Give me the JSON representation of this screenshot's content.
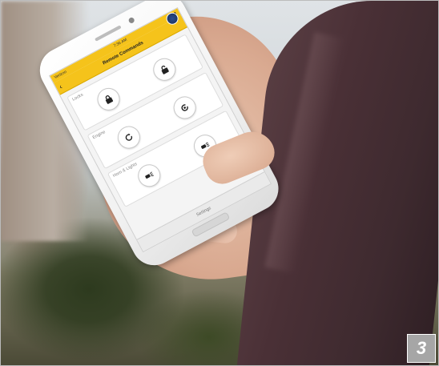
{
  "statusbar": {
    "carrier": "Verizon",
    "time": "7:36 AM",
    "battery": ""
  },
  "header": {
    "title": "Remote Commands"
  },
  "sections": [
    {
      "label": "Locks",
      "buttons": [
        {
          "icon": "lock-icon"
        },
        {
          "icon": "unlock-icon"
        }
      ]
    },
    {
      "label": "Engine",
      "buttons": [
        {
          "icon": "engine-start-icon"
        },
        {
          "icon": "engine-stop-icon"
        }
      ]
    },
    {
      "label": "Horn & Lights",
      "buttons": [
        {
          "icon": "horn-lights-icon"
        },
        {
          "icon": "lights-icon"
        }
      ]
    }
  ],
  "bottom_bar": {
    "label": "Settings"
  },
  "figure": {
    "number": "3"
  },
  "colors": {
    "accent": "#f5c31b",
    "badge": "#a6a6a6",
    "sleeve": "#4a3036"
  }
}
